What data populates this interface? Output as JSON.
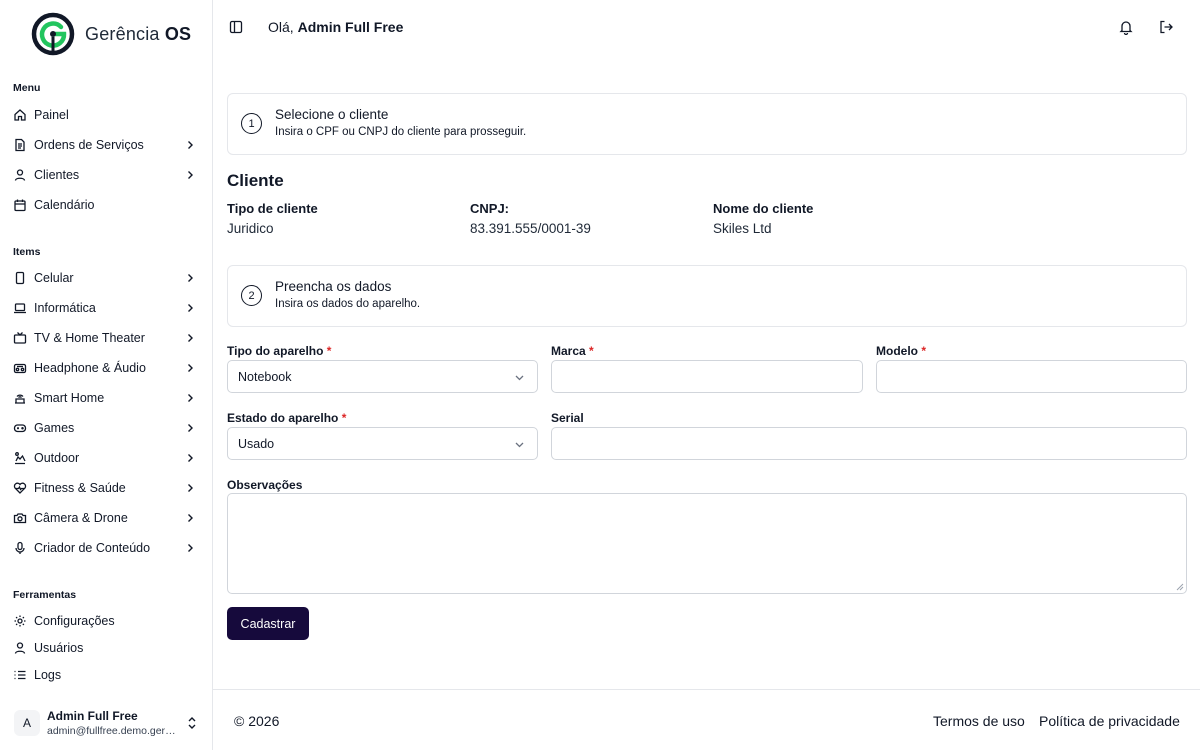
{
  "brand": {
    "name_light": "Gerência",
    "name_bold": "OS"
  },
  "sidebar": {
    "menu_title": "Menu",
    "menu_items": [
      {
        "label": "Painel",
        "icon": "home-icon"
      },
      {
        "label": "Ordens de Serviços",
        "icon": "document-icon"
      },
      {
        "label": "Clientes",
        "icon": "user-icon"
      },
      {
        "label": "Calendário",
        "icon": "calendar-icon"
      }
    ],
    "items_title": "Items",
    "category_items": [
      {
        "label": "Celular",
        "icon": "smartphone-icon"
      },
      {
        "label": "Informática",
        "icon": "laptop-icon"
      },
      {
        "label": "TV & Home Theater",
        "icon": "tv-icon"
      },
      {
        "label": "Headphone & Áudio",
        "icon": "speaker-icon"
      },
      {
        "label": "Smart Home",
        "icon": "smart-home-icon"
      },
      {
        "label": "Games",
        "icon": "gamepad-icon"
      },
      {
        "label": "Outdoor",
        "icon": "outdoor-icon"
      },
      {
        "label": "Fitness & Saúde",
        "icon": "heart-pulse-icon"
      },
      {
        "label": "Câmera & Drone",
        "icon": "camera-icon"
      },
      {
        "label": "Criador de Conteúdo",
        "icon": "microphone-icon"
      }
    ],
    "tools_title": "Ferramentas",
    "tool_items": [
      {
        "label": "Configurações",
        "icon": "gear-icon"
      },
      {
        "label": "Usuários",
        "icon": "user-icon"
      },
      {
        "label": "Logs",
        "icon": "list-icon"
      }
    ],
    "user": {
      "initial": "A",
      "name": "Admin Full Free",
      "email": "admin@fullfree.demo.gerenciaos.com"
    }
  },
  "header": {
    "greeting_prefix": "Olá,",
    "user_name": "Admin Full Free"
  },
  "steps": [
    {
      "number": "1",
      "title": "Selecione o cliente",
      "description": "Insira o CPF ou CNPJ do cliente para prosseguir."
    },
    {
      "number": "2",
      "title": "Preencha os dados",
      "description": "Insira os dados do aparelho."
    }
  ],
  "client": {
    "section_title": "Cliente",
    "type_label": "Tipo de cliente",
    "type_value": "Juridico",
    "doc_label": "CNPJ:",
    "doc_value": "83.391.555/0001-39",
    "name_label": "Nome do cliente",
    "name_value": "Skiles Ltd"
  },
  "form": {
    "device_type": {
      "label": "Tipo do aparelho",
      "value": "Notebook",
      "required": "*"
    },
    "brand": {
      "label": "Marca",
      "value": "",
      "required": "*"
    },
    "model": {
      "label": "Modelo",
      "value": "",
      "required": "*"
    },
    "device_state": {
      "label": "Estado do aparelho",
      "value": "Usado",
      "required": "*"
    },
    "serial": {
      "label": "Serial",
      "value": ""
    },
    "notes": {
      "label": "Observações",
      "value": ""
    },
    "submit_label": "Cadastrar"
  },
  "footer": {
    "copyright": "© 2026",
    "terms": "Termos de uso",
    "privacy": "Política de privacidade"
  },
  "colors": {
    "primary": "#160a3c",
    "logo_green": "#22c55e",
    "logo_dark": "#111827",
    "required": "#dc2626"
  }
}
